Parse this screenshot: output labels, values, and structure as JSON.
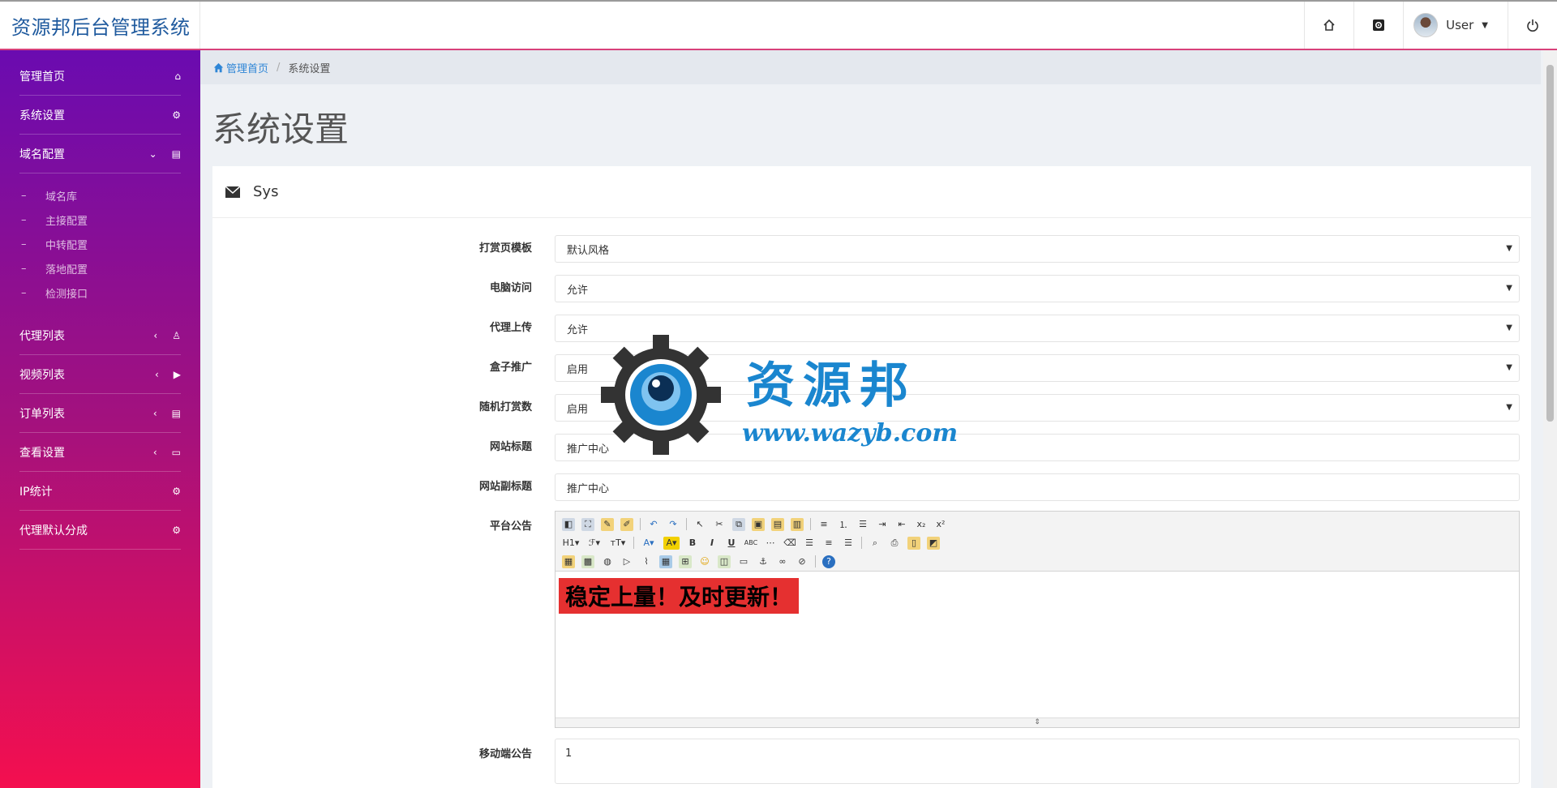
{
  "header": {
    "brand": "资源邦后台管理系统",
    "user_name": "User"
  },
  "sidebar": {
    "items": [
      {
        "label": "管理首页",
        "icon": "home-icon"
      },
      {
        "label": "系统设置",
        "icon": "gear-icon"
      },
      {
        "label": "域名配置",
        "icon": "clipboard-icon",
        "expanded": true,
        "children": [
          "域名库",
          "主接配置",
          "中转配置",
          "落地配置",
          "检测接口"
        ]
      },
      {
        "label": "代理列表",
        "icon": "user-icon"
      },
      {
        "label": "视频列表",
        "icon": "play-icon"
      },
      {
        "label": "订单列表",
        "icon": "clipboard-icon"
      },
      {
        "label": "查看设置",
        "icon": "laptop-icon"
      },
      {
        "label": "IP统计",
        "icon": "gear-icon"
      },
      {
        "label": "代理默认分成",
        "icon": "gear-icon"
      }
    ]
  },
  "breadcrumb": {
    "home": "管理首页",
    "current": "系统设置"
  },
  "page": {
    "title": "系统设置",
    "panel_title": "Sys"
  },
  "form": {
    "fields": [
      {
        "label": "打赏页模板",
        "value": "默认风格",
        "type": "select"
      },
      {
        "label": "电脑访问",
        "value": "允许",
        "type": "select"
      },
      {
        "label": "代理上传",
        "value": "允许",
        "type": "select"
      },
      {
        "label": "盒子推广",
        "value": "启用",
        "type": "select"
      },
      {
        "label": "随机打赏数",
        "value": "启用",
        "type": "select"
      },
      {
        "label": "网站标题",
        "value": "推广中心",
        "type": "input"
      },
      {
        "label": "网站副标题",
        "value": "推广中心",
        "type": "input"
      }
    ],
    "announce_label": "平台公告",
    "announce_text": "稳定上量！及时更新！",
    "mobile_label": "移动端公告",
    "mobile_value": "1"
  },
  "watermark": {
    "cn": "资源邦",
    "en": "www.wazyb.com"
  },
  "colors": {
    "sidebar_top": "#6a0bb0",
    "sidebar_bottom": "#f40f4f",
    "accent": "#2f86d6",
    "notice_bg": "#e53030"
  }
}
